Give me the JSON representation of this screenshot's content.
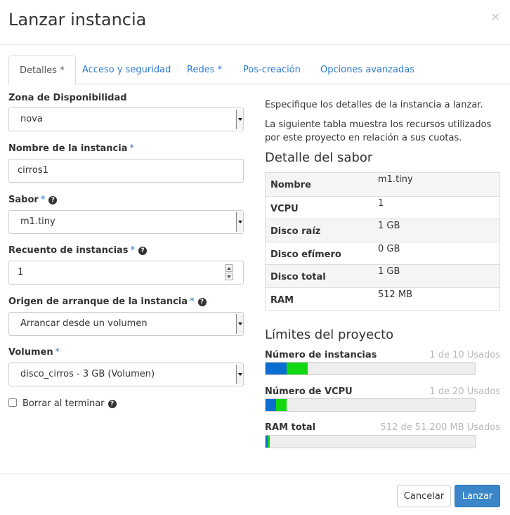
{
  "modal": {
    "title": "Lanzar instancia",
    "close_label": "×"
  },
  "tabs": [
    {
      "label": "Detalles *",
      "active": true
    },
    {
      "label": "Acceso y seguridad",
      "active": false
    },
    {
      "label": "Redes *",
      "active": false
    },
    {
      "label": "Pos-creación",
      "active": false
    },
    {
      "label": "Opciones avanzadas",
      "active": false
    }
  ],
  "form": {
    "required_mark": "*",
    "availability_zone": {
      "label": "Zona de Disponibilidad",
      "value": "nova"
    },
    "instance_name": {
      "label": "Nombre de la instancia",
      "value": "cirros1"
    },
    "flavor": {
      "label": "Sabor",
      "value": "m1.tiny"
    },
    "instance_count": {
      "label": "Recuento de instancias",
      "value": "1"
    },
    "boot_source": {
      "label": "Origen de arranque de la instancia",
      "value": "Arrancar desde un volumen"
    },
    "volume": {
      "label": "Volumen",
      "value": "disco_cirros - 3 GB (Volumen)"
    },
    "delete_on_terminate": {
      "label": "Borrar al terminar",
      "checked": false
    }
  },
  "info": {
    "intro": "Especifique los detalles de la instancia a lanzar.",
    "table_note": "La siguiente tabla muestra los recursos utilizados por este proyecto en relación a sus cuotas.",
    "flavor_heading": "Detalle del sabor",
    "flavor_rows": [
      {
        "key": "Nombre",
        "value": "m1.tiny"
      },
      {
        "key": "VCPU",
        "value": "1"
      },
      {
        "key": "Disco raíz",
        "value": "1 GB"
      },
      {
        "key": "Disco efímero",
        "value": "0 GB"
      },
      {
        "key": "Disco total",
        "value": "1 GB"
      },
      {
        "key": "RAM",
        "value": "512 MB"
      }
    ],
    "limits_heading": "Límites del proyecto",
    "quotas": [
      {
        "label": "Número de instancias",
        "used_text": "1 de 10 Usados",
        "used_fraction": 0.1,
        "added_fraction": 0.1
      },
      {
        "label": "Número de VCPU",
        "used_text": "1 de 20 Usados",
        "used_fraction": 0.05,
        "added_fraction": 0.05
      },
      {
        "label": "RAM total",
        "used_text": "512 de 51.200 MB Usados",
        "used_fraction": 0.01,
        "added_fraction": 0.01
      }
    ]
  },
  "footer": {
    "cancel_label": "Cancelar",
    "launch_label": "Lanzar"
  },
  "colors": {
    "accent": "#2c7bd0",
    "bar_used": "#0a6ed1",
    "bar_added": "#11d811",
    "primary_button": "#3a86c8"
  },
  "icons": {
    "help": "question-circle-icon",
    "close": "close-icon"
  }
}
